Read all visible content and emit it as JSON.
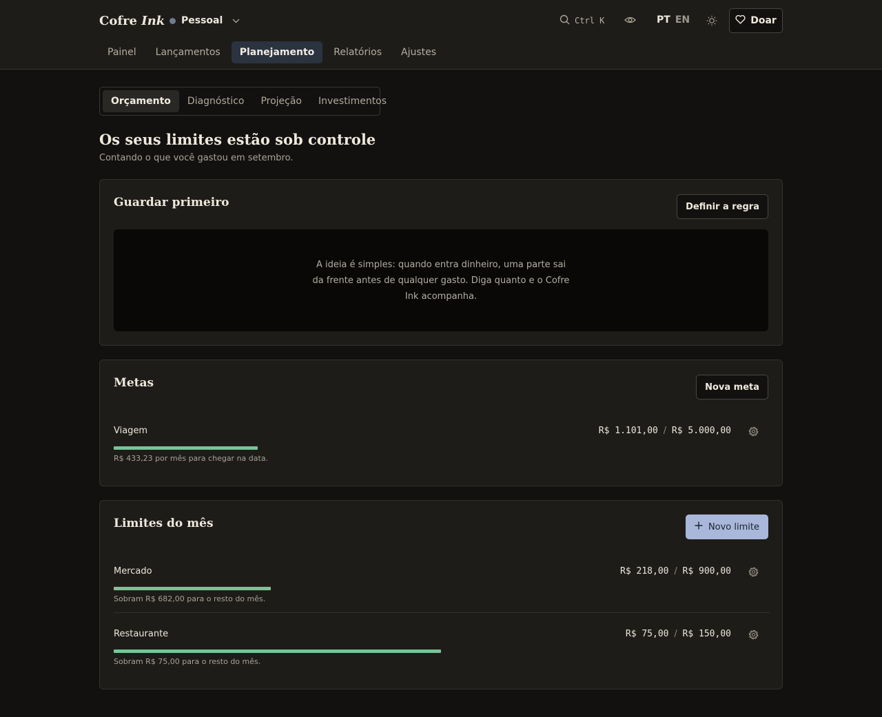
{
  "header": {
    "brand_main": "Cofre",
    "brand_ink": "Ink",
    "profile": "Pessoal",
    "search_shortcut": "Ctrl K",
    "lang_active": "PT",
    "lang_other": "EN",
    "donate_label": "Doar"
  },
  "nav": [
    {
      "label": "Painel",
      "active": false
    },
    {
      "label": "Lançamentos",
      "active": false
    },
    {
      "label": "Planejamento",
      "active": true
    },
    {
      "label": "Relatórios",
      "active": false
    },
    {
      "label": "Ajustes",
      "active": false
    }
  ],
  "subtabs": [
    {
      "label": "Orçamento",
      "active": true
    },
    {
      "label": "Diagnóstico",
      "active": false
    },
    {
      "label": "Projeção",
      "active": false
    },
    {
      "label": "Investimentos",
      "active": false
    }
  ],
  "page": {
    "title": "Os seus limites estão sob controle",
    "subtitle": "Contando o que você gastou em setembro."
  },
  "save_first": {
    "title": "Guardar primeiro",
    "button": "Definir a regra",
    "empty_text": "A ideia é simples: quando entra dinheiro, uma parte sai da frente antes de qualquer gasto. Diga quanto e o Cofre Ink acompanha."
  },
  "goals": {
    "title": "Metas",
    "button": "Nova meta",
    "items": [
      {
        "name": "Viagem",
        "current": "R$ 1.101,00",
        "target": "R$ 5.000,00",
        "progress": 0.22,
        "note": "R$ 433,23 por mês para chegar na data."
      }
    ]
  },
  "limits": {
    "title": "Limites do mês",
    "button": "Novo limite",
    "items": [
      {
        "name": "Mercado",
        "current": "R$ 218,00",
        "target": "R$ 900,00",
        "progress": 0.24,
        "note": "Sobram R$ 682,00 para o resto do mês."
      },
      {
        "name": "Restaurante",
        "current": "R$ 75,00",
        "target": "R$ 150,00",
        "progress": 0.5,
        "note": "Sobram R$ 75,00 para o resto do mês."
      }
    ]
  },
  "amount_separator": "/",
  "colors": {
    "background": "#121110",
    "card": "#1e1c19",
    "accent": "#a9b8da",
    "progress": "#78c497",
    "nav_active": "#2b3240"
  },
  "icons": {
    "profile": "dot-icon",
    "profile_menu": "chevron-down-icon",
    "search": "search-icon",
    "privacy": "eye-icon",
    "theme": "sun-icon",
    "donate": "heart-icon",
    "item_settings": "gear-icon",
    "add": "plus-icon"
  }
}
